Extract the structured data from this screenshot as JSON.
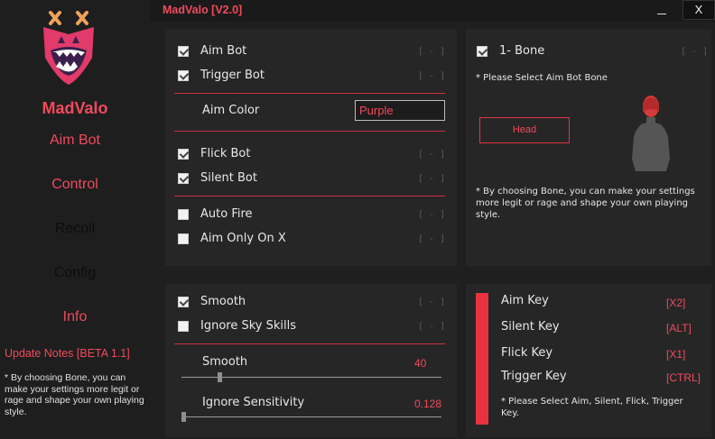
{
  "app": {
    "title": "MadValo [V2.0]",
    "brand": "MadValo",
    "close_label": "X"
  },
  "colors": {
    "accent": "#f04a5c",
    "bg": "#1f1f1f",
    "panel": "#262626"
  },
  "sidebar": {
    "items": [
      {
        "label": "Aim Bot",
        "active": true
      },
      {
        "label": "Control",
        "active": true
      },
      {
        "label": "Recoil",
        "active": false
      },
      {
        "label": "Config",
        "active": false
      },
      {
        "label": "Info",
        "active": true
      }
    ],
    "update_title": "Update Notes [BETA 1.1]",
    "update_text": "* By choosing Bone, you can make your settings more legit or rage and shape your own playing style."
  },
  "aim_panel": {
    "options": [
      {
        "label": "Aim Bot",
        "checked": true,
        "key": "[ - ]"
      },
      {
        "label": "Trigger Bot",
        "checked": true,
        "key": "[ - ]"
      },
      {
        "label": "Flick Bot",
        "checked": true,
        "key": "[ - ]"
      },
      {
        "label": "Silent Bot",
        "checked": true,
        "key": "[ - ]"
      },
      {
        "label": "Auto Fire",
        "checked": false,
        "key": "[ - ]"
      },
      {
        "label": "Aim Only On X",
        "checked": false,
        "key": "[ - ]"
      }
    ],
    "aim_color_label": "Aim Color",
    "aim_color_value": "Purple"
  },
  "bone_panel": {
    "option": {
      "label": "1- Bone",
      "checked": true,
      "key": "[ - ]"
    },
    "select_note": "* Please Select Aim Bot Bone",
    "selected_bone": "Head",
    "note": "* By choosing Bone, you can make your settings more legit or rage and shape your own playing style."
  },
  "smooth_panel": {
    "options": [
      {
        "label": "Smooth",
        "checked": true,
        "key": "[ - ]"
      },
      {
        "label": "Ignore Sky Skills",
        "checked": false,
        "key": "[ - ]"
      }
    ],
    "sliders": [
      {
        "label": "Smooth",
        "value": "40",
        "fraction": 0.14
      },
      {
        "label": "Ignore Sensitivity",
        "value": "0.128",
        "fraction": 0.0
      }
    ]
  },
  "keys_panel": {
    "keys": [
      {
        "label": "Aim Key",
        "value": "[X2]"
      },
      {
        "label": "Silent Key",
        "value": "[ALT]"
      },
      {
        "label": "Flick Key",
        "value": "[X1]"
      },
      {
        "label": "Trigger Key",
        "value": "[CTRL]"
      }
    ],
    "note": "* Please Select Aim, Silent, Flick, Trigger Key."
  }
}
